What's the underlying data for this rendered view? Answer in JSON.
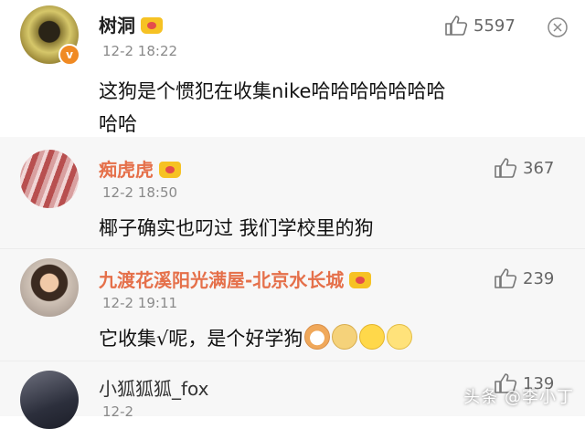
{
  "comments": [
    {
      "username": "树洞",
      "time": "12-2 18:22",
      "text_line1": "这狗是个惯犯在收集nike哈哈哈哈哈哈哈",
      "text_line2": "哈哈",
      "likes": "5597",
      "verified": "v"
    },
    {
      "username": "痴虎虎",
      "time": "12-2 18:50",
      "text": "椰子确实也叼过 我们学校里的狗",
      "likes": "367"
    },
    {
      "username": "九渡花溪阳光满屋-北京水长城",
      "time": "12-2 19:11",
      "text": "它收集√呢，是个好学狗",
      "likes": "239"
    },
    {
      "username": "小狐狐狐_fox",
      "time": "12-2",
      "likes": "139"
    }
  ],
  "watermark": "头条 @李小丁",
  "colors": {
    "vip_name": "#e5704a",
    "background_alt": "#f7f7f7",
    "verified_badge": "#f08a23"
  },
  "icons": [
    "thumb-up-icon",
    "more-menu-icon",
    "vip-crown-icon",
    "dog-emoji-icon",
    "doge-emoji-icon",
    "laugh-cry-emoji-icon",
    "grin-emoji-icon"
  ]
}
